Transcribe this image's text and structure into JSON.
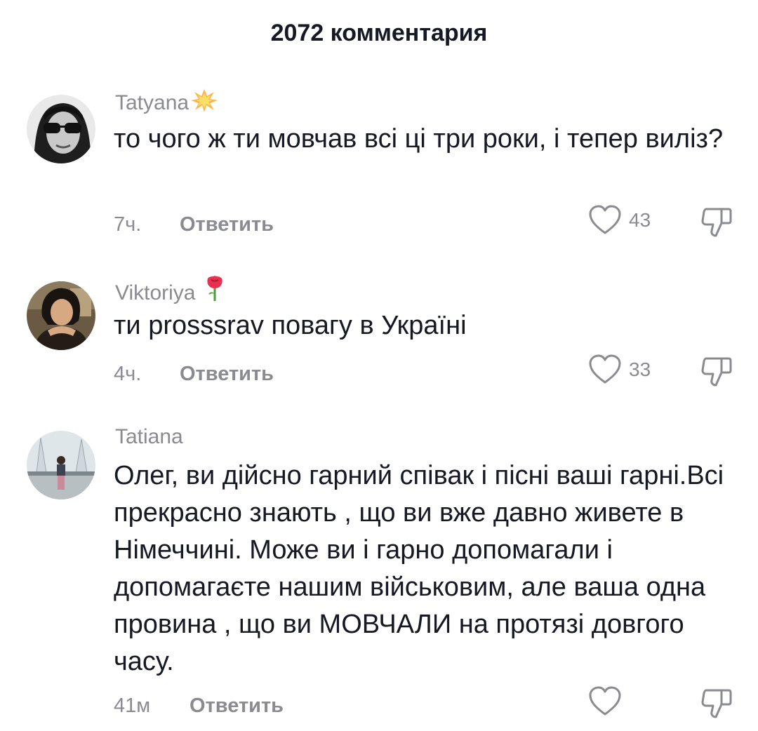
{
  "header": {
    "title": "2072 комментария"
  },
  "comments": [
    {
      "username": "Tatyana",
      "username_emoji": "collision-emoji",
      "text": "то чого ж ти мовчав всі ці три роки, і тепер виліз?",
      "time": "7ч.",
      "reply_label": "Ответить",
      "likes": "43",
      "avatar": "woman-with-sunglasses-photo"
    },
    {
      "username": "Viktoriya",
      "username_emoji": "rose-emoji",
      "text": "ти prosssrav повагу в Україні",
      "time": "4ч.",
      "reply_label": "Ответить",
      "likes": "33",
      "avatar": "woman-portrait-photo"
    },
    {
      "username": "Tatiana",
      "username_emoji": "",
      "text": "Олег, ви дійсно гарний співак і пісні ваші гарні.Всі прекрасно знають , що ви вже давно живете в Німеччині. Може ви і гарно допомагали і допомагаєте нашим військовим, але ваша одна провина , що ви МОВЧАЛИ на протязі довгого часу.",
      "time": "41м",
      "reply_label": "Ответить",
      "likes": "",
      "avatar": "woman-near-fountain-photo"
    }
  ],
  "colors": {
    "text_primary": "#161823",
    "text_secondary": "#8a8b91",
    "background": "#ffffff"
  },
  "icons": [
    "heart-outline-icon",
    "thumbs-down-outline-icon"
  ]
}
